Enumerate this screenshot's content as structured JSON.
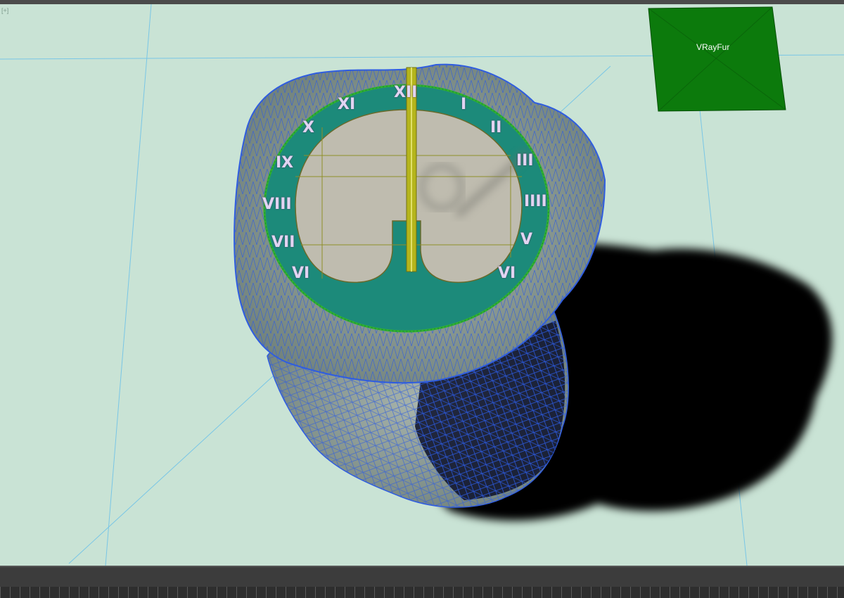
{
  "viewport": {
    "corner_label": "[+]",
    "helper_label": "VRayFur",
    "colors": {
      "background": "#c9e3d5",
      "wireframe": "#2f5de0",
      "helper": "#0c7a0c",
      "ring": "#1c8a7a",
      "gnomon": "#b5b51c"
    }
  },
  "dial": {
    "numerals": [
      "XII",
      "I",
      "II",
      "III",
      "IIII",
      "V",
      "VI",
      "VI",
      "VII",
      "VIII",
      "IX",
      "X",
      "XI"
    ]
  },
  "timeline": {}
}
